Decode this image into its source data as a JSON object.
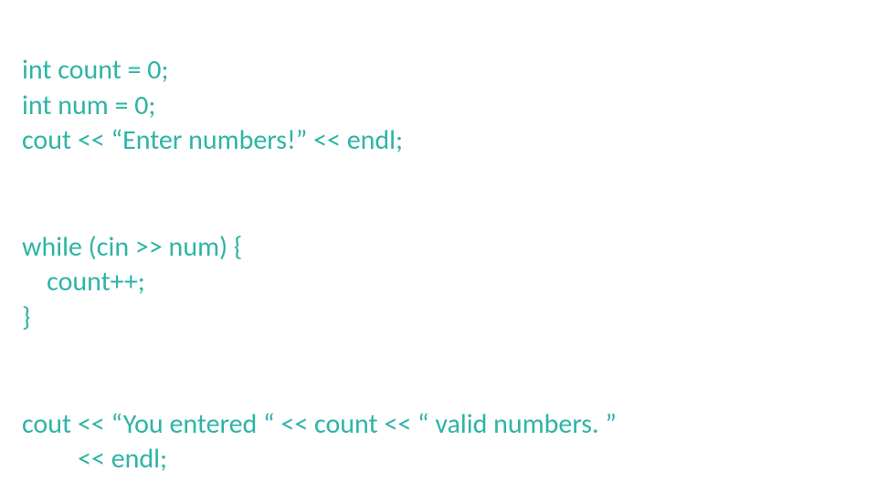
{
  "code": {
    "p1_l1": "int count = 0;",
    "p1_l2": "int num = 0;",
    "p1_l3": "cout << “Enter numbers!” << endl;",
    "p2_l1": "while (cin >> num) {",
    "p2_l2": "    count++;",
    "p2_l3": "}",
    "p3_l1": "cout << “You entered “ << count << “ valid numbers. ”",
    "p3_l2": "         << endl;"
  }
}
